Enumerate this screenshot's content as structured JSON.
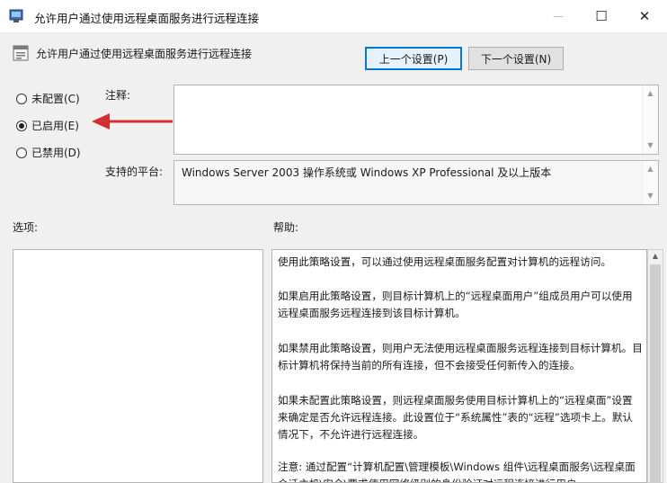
{
  "window": {
    "title": "允许用户通过使用远程桌面服务进行远程连接",
    "minimize": "—",
    "maximize": "☐",
    "close": "✕"
  },
  "header": {
    "policy_title": "允许用户通过使用远程桌面服务进行远程连接",
    "prev_button": "上一个设置(P)",
    "next_button": "下一个设置(N)"
  },
  "state": {
    "options": [
      {
        "label": "未配置(C)",
        "checked": false
      },
      {
        "label": "已启用(E)",
        "checked": true
      },
      {
        "label": "已禁用(D)",
        "checked": false
      }
    ]
  },
  "fields": {
    "comment_label": "注释:",
    "comment_value": "",
    "platform_label": "支持的平台:",
    "platform_value": "Windows Server 2003 操作系统或 Windows XP Professional 及以上版本"
  },
  "sections": {
    "options_label": "选项:",
    "help_label": "帮助:"
  },
  "help": {
    "paragraphs": [
      "使用此策略设置，可以通过使用远程桌面服务配置对计算机的远程访问。",
      "如果启用此策略设置，则目标计算机上的“远程桌面用户”组成员用户可以使用远程桌面服务远程连接到该目标计算机。",
      "如果禁用此策略设置，则用户无法使用远程桌面服务远程连接到目标计算机。目标计算机将保持当前的所有连接，但不会接受任何新传入的连接。",
      "如果未配置此策略设置，则远程桌面服务使用目标计算机上的“远程桌面”设置来确定是否允许远程连接。此设置位于“系统属性”表的“远程”选项卡上。默认情况下，不允许进行远程连接。",
      "注意: 通过配置“计算机配置\\管理模板\\Windows 组件\\远程桌面服务\\远程桌面会话主机\\安全\\要求使用网络级别的身份验证对远程连接进行用户"
    ]
  },
  "colors": {
    "annotation_arrow": "#d32f2f",
    "focus_border": "#0078d7"
  }
}
